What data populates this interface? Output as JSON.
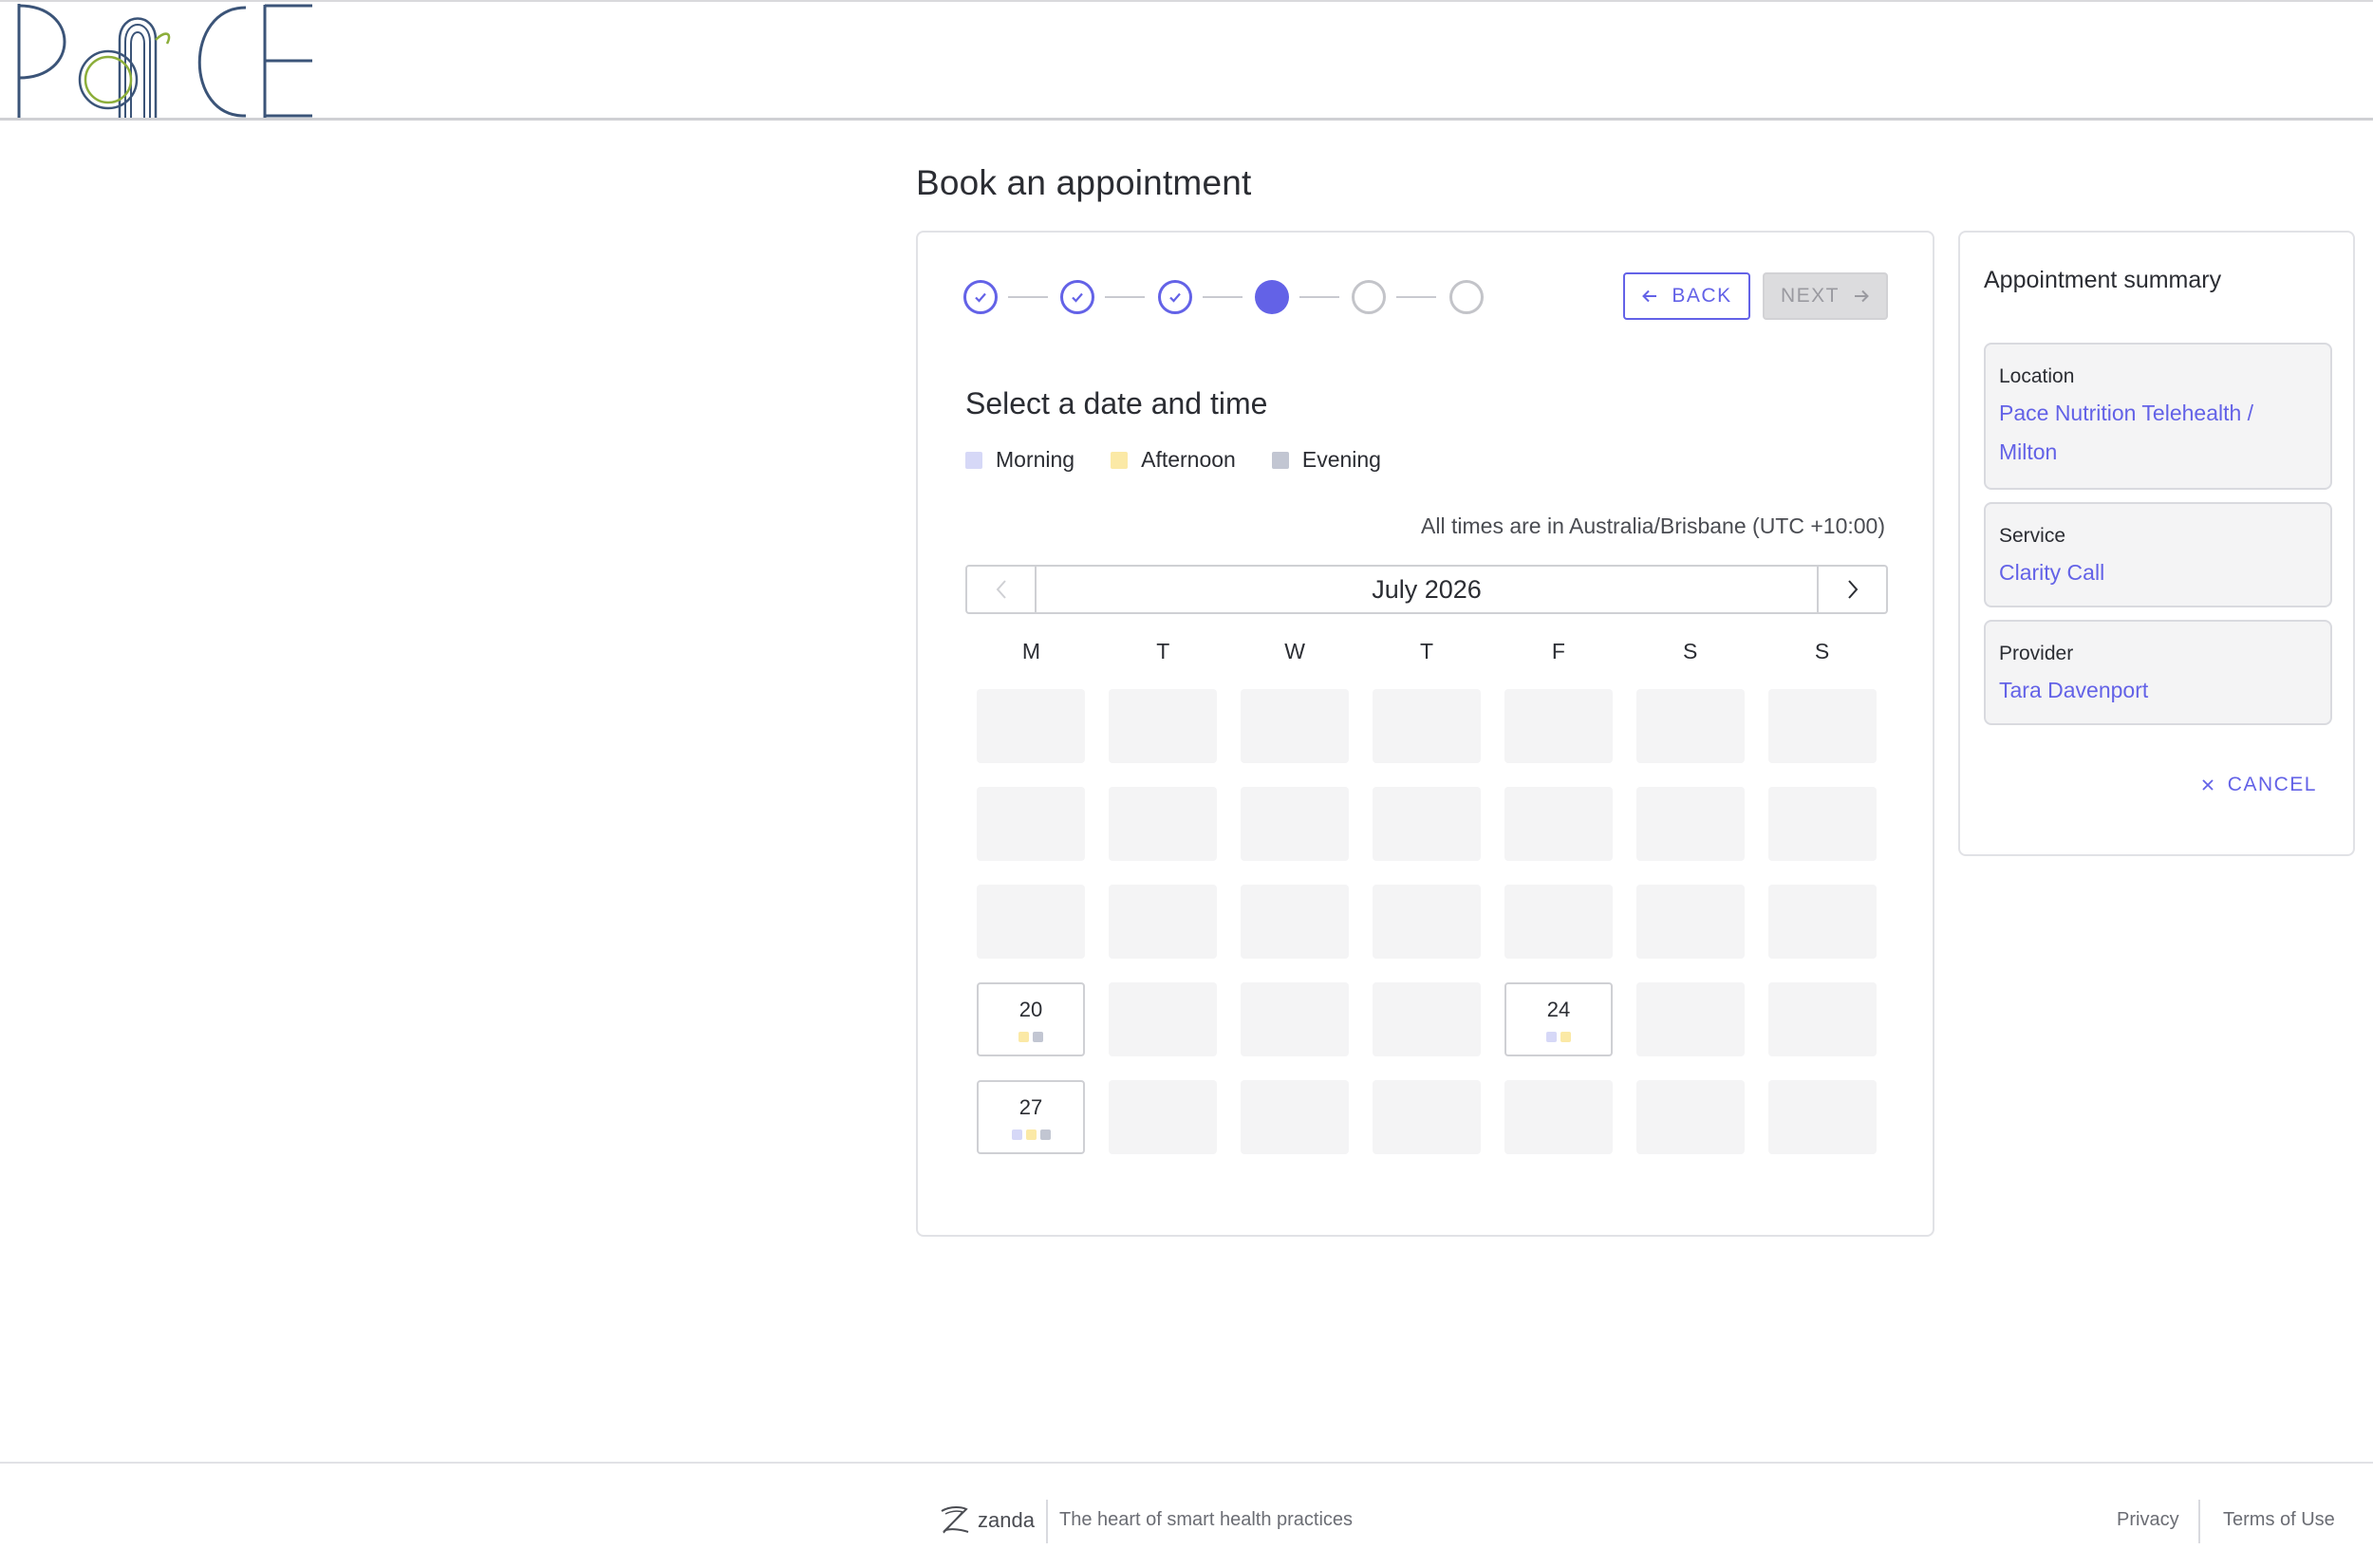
{
  "header": {
    "logo_text": "PaCE"
  },
  "page": {
    "title": "Book an appointment"
  },
  "wizard": {
    "steps": [
      "done",
      "done",
      "done",
      "current",
      "todo",
      "todo"
    ],
    "back_label": "BACK",
    "next_label": "NEXT"
  },
  "section": {
    "title": "Select a date and time"
  },
  "legend": [
    {
      "label": "Morning",
      "color": "#d6d8f7"
    },
    {
      "label": "Afternoon",
      "color": "#fbe9a6"
    },
    {
      "label": "Evening",
      "color": "#c2c6d2"
    }
  ],
  "timezone_note": "All times are in Australia/Brisbane (UTC +10:00)",
  "calendar": {
    "month_label": "July 2026",
    "weekdays": [
      "M",
      "T",
      "W",
      "T",
      "F",
      "S",
      "S"
    ],
    "available_days": [
      {
        "day": "20",
        "slots": [
          "afternoon",
          "evening"
        ]
      },
      {
        "day": "24",
        "slots": [
          "morning",
          "afternoon"
        ]
      },
      {
        "day": "27",
        "slots": [
          "morning",
          "afternoon",
          "evening"
        ]
      }
    ]
  },
  "summary": {
    "title": "Appointment summary",
    "location_label": "Location",
    "location_value": "Pace Nutrition Telehealth / Milton",
    "service_label": "Service",
    "service_value": "Clarity Call",
    "provider_label": "Provider",
    "provider_value": "Tara Davenport",
    "cancel_label": "CANCEL"
  },
  "footer": {
    "brand": "zanda",
    "tagline": "The heart of smart health practices",
    "privacy": "Privacy",
    "terms": "Terms of Use"
  },
  "colors": {
    "accent": "#6362e7",
    "muted_cell": "#f4f4f5"
  }
}
